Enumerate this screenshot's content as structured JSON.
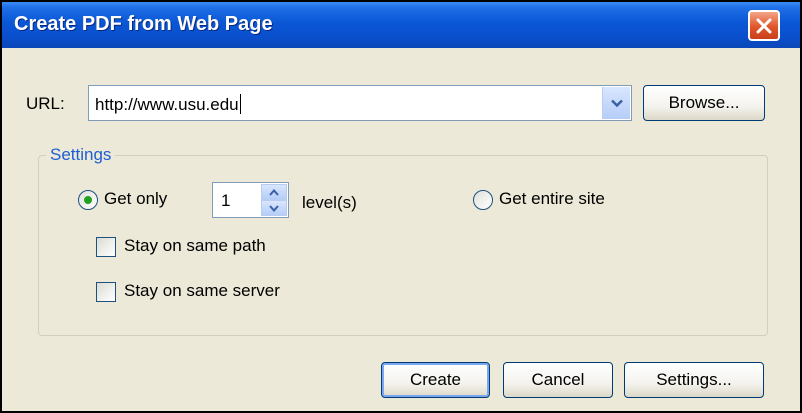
{
  "window": {
    "title": "Create PDF from Web Page"
  },
  "url": {
    "label": "URL:",
    "value": "http://www.usu.edu"
  },
  "buttons": {
    "browse": "Browse...",
    "create": "Create",
    "cancel": "Cancel",
    "settings": "Settings..."
  },
  "settings_group": {
    "legend": "Settings",
    "get_only": {
      "label": "Get only",
      "selected": true
    },
    "levels": {
      "value": "1",
      "unit_label": "level(s)"
    },
    "get_entire_site": {
      "label": "Get entire site",
      "selected": false
    },
    "stay_on_same_path": {
      "label": "Stay on same path",
      "checked": false
    },
    "stay_on_same_server": {
      "label": "Stay on same server",
      "checked": false
    }
  },
  "colors": {
    "titlebar": "#0a4fcd",
    "close_button": "#e0552b",
    "dialog_background": "#ece9d8",
    "group_legend": "#1d5ed6",
    "radio_dot": "#21a121"
  },
  "icons": {
    "close": "close-x-icon",
    "dropdown": "chevron-down-icon",
    "spin_up": "arrow-up-icon",
    "spin_down": "arrow-down-icon"
  }
}
